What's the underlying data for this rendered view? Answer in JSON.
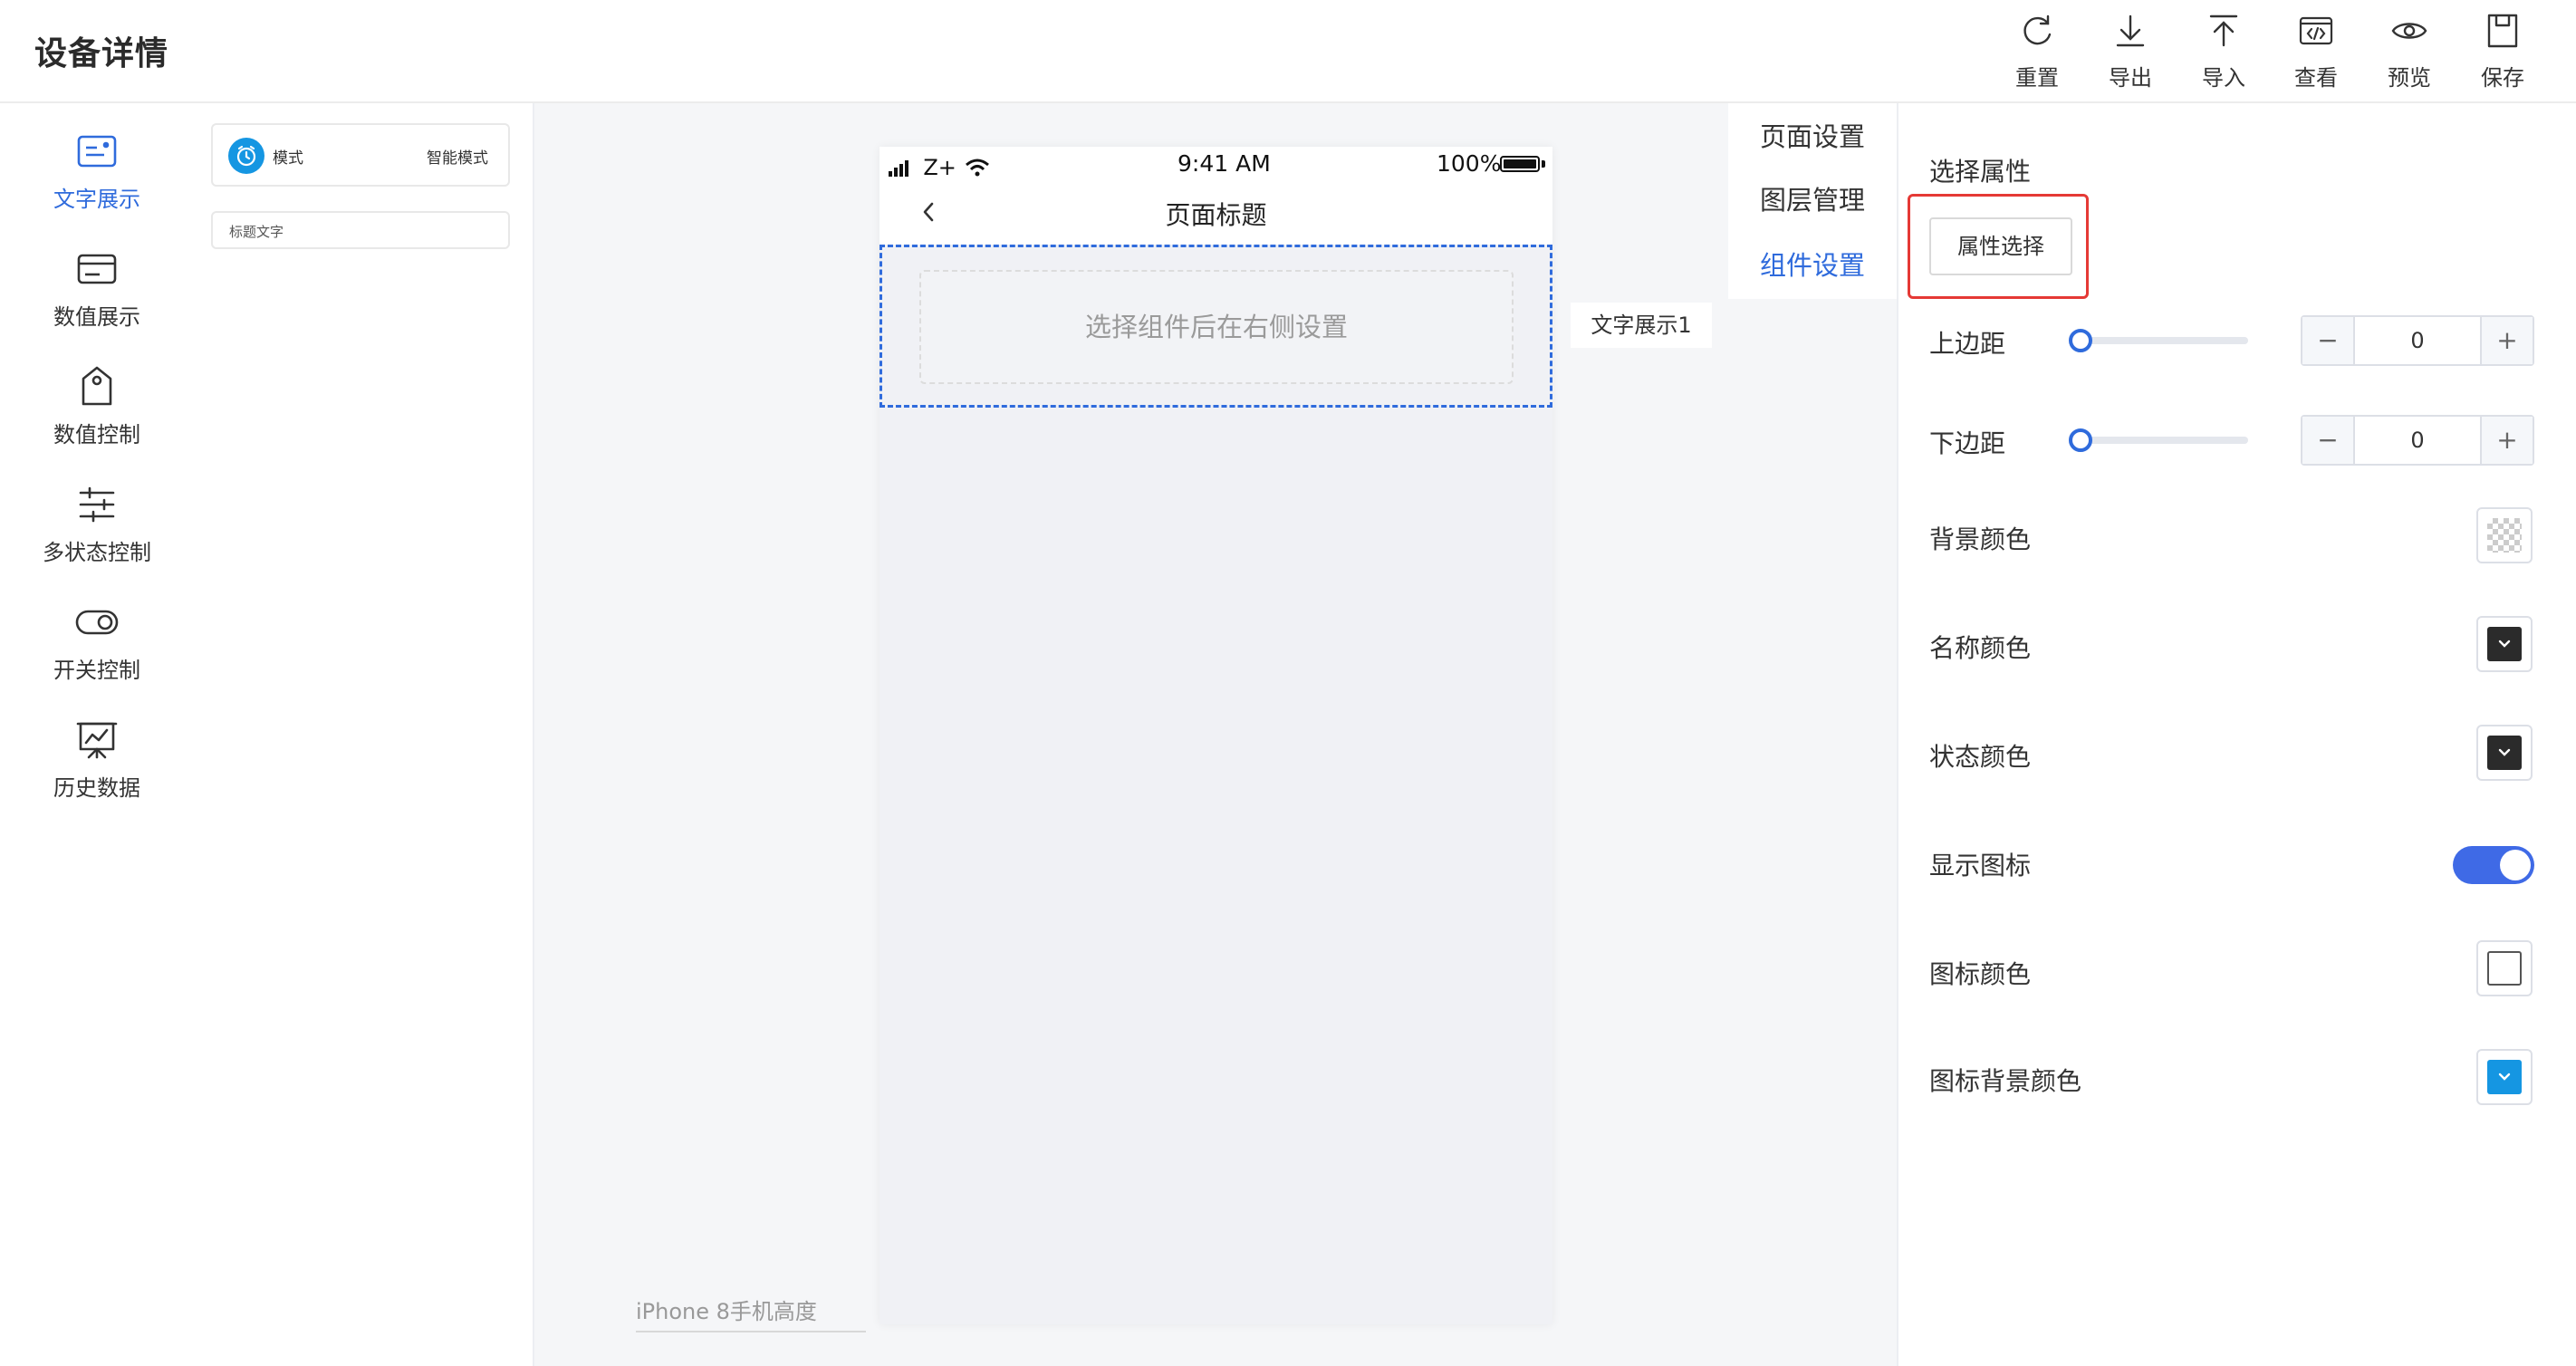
{
  "header": {
    "title": "设备详情",
    "tools": [
      {
        "label": "重置",
        "icon": "refresh-icon"
      },
      {
        "label": "导出",
        "icon": "download-icon"
      },
      {
        "label": "导入",
        "icon": "upload-icon"
      },
      {
        "label": "查看",
        "icon": "code-icon"
      },
      {
        "label": "预览",
        "icon": "eye-icon"
      },
      {
        "label": "保存",
        "icon": "save-icon"
      }
    ]
  },
  "sidebar": {
    "active_index": 0,
    "items": [
      {
        "label": "文字展示",
        "icon": "text-display-icon"
      },
      {
        "label": "数值展示",
        "icon": "card-icon"
      },
      {
        "label": "数值控制",
        "icon": "tag-icon"
      },
      {
        "label": "多状态控制",
        "icon": "sliders-icon"
      },
      {
        "label": "开关控制",
        "icon": "toggle-icon"
      },
      {
        "label": "历史数据",
        "icon": "chart-board-icon"
      }
    ]
  },
  "components": {
    "card1": {
      "name": "模式",
      "value": "智能模式",
      "icon": "clock-icon"
    },
    "card2": {
      "label": "标题文字"
    }
  },
  "phone": {
    "carrier": "Z+",
    "time": "9:41 AM",
    "battery": "100%",
    "page_title": "页面标题",
    "placeholder": "选择组件后在右侧设置",
    "component_tag": "文字展示1",
    "height_label": "iPhone 8手机高度"
  },
  "settings_tabs": {
    "active_index": 2,
    "items": [
      "页面设置",
      "图层管理",
      "组件设置"
    ]
  },
  "settings": {
    "select_attr_label": "选择属性",
    "attr_button": "属性选择",
    "top_margin": {
      "label": "上边距",
      "value": "0",
      "slider": 0
    },
    "bottom_margin": {
      "label": "下边距",
      "value": "0",
      "slider": 0
    },
    "bg_color": {
      "label": "背景颜色",
      "color": "transparent"
    },
    "name_color": {
      "label": "名称颜色",
      "color": "#2b2b2b"
    },
    "status_color": {
      "label": "状态颜色",
      "color": "#2b2b2b"
    },
    "show_icon": {
      "label": "显示图标",
      "on": true
    },
    "icon_color": {
      "label": "图标颜色",
      "color": "#ffffff"
    },
    "icon_bg_color": {
      "label": "图标背景颜色",
      "color": "#1596e2"
    }
  },
  "colors": {
    "accent": "#2f6bdc",
    "highlight": "#e53935",
    "toggle": "#3f6ae6"
  }
}
